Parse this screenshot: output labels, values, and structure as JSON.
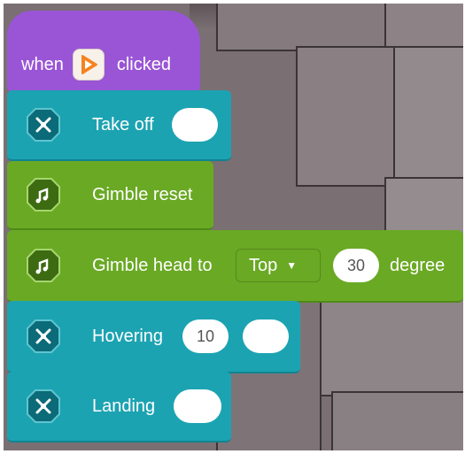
{
  "hat_block": {
    "prefix": "when",
    "suffix": "clicked",
    "icon": "play-icon"
  },
  "blocks": [
    {
      "label": "Take off",
      "icon": "drone-icon",
      "color": "#1ca3b2"
    },
    {
      "label": "Gimble reset",
      "icon": "gimbal-icon",
      "color": "#6aa924"
    },
    {
      "label": "Gimble head to",
      "icon": "gimbal-icon",
      "color": "#6aa924",
      "dropdown": "Top",
      "value": "30",
      "unit": "degree"
    },
    {
      "label": "Hovering",
      "icon": "drone-icon",
      "color": "#1ca3b2",
      "value": "10"
    },
    {
      "label": "Landing",
      "icon": "drone-icon",
      "color": "#1ca3b2"
    }
  ],
  "colors": {
    "event": "#9a55d6",
    "flight": "#1ca3b2",
    "gimbal": "#6aa924"
  }
}
